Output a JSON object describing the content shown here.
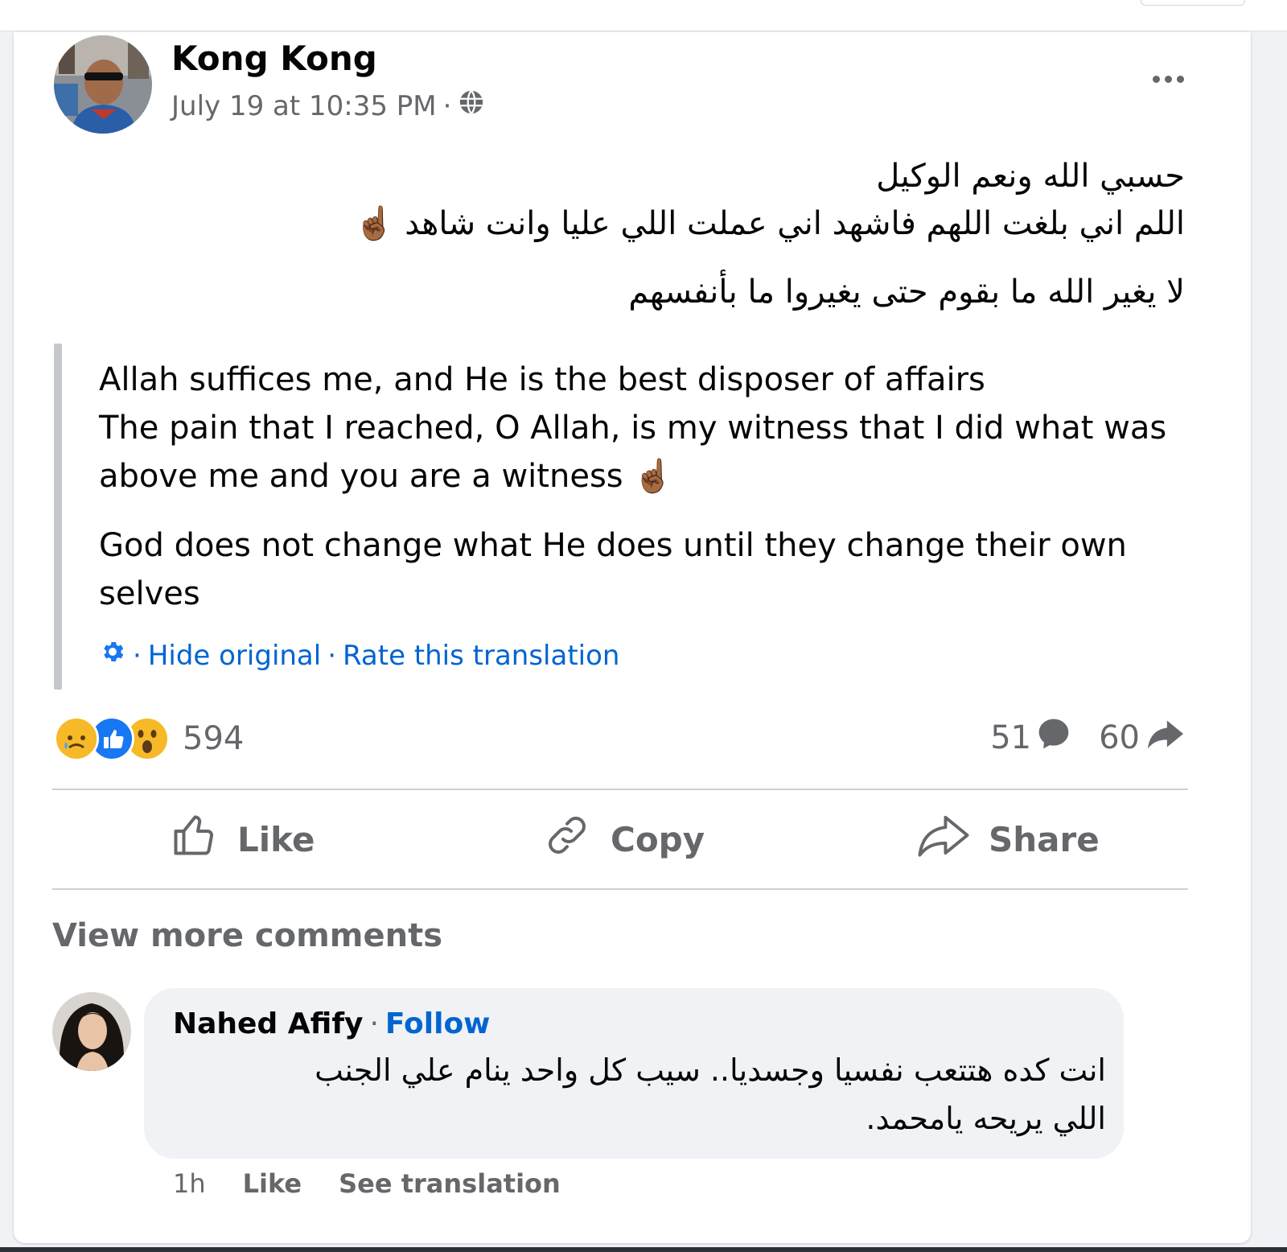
{
  "post": {
    "author": "Kong Kong",
    "timestamp": "July 19 at 10:35 PM",
    "separator": "·",
    "privacy_icon": "globe-icon",
    "more_icon": "more-options-icon",
    "original_lines": [
      "حسبي الله ونعم الوكيل",
      "اللم اني بلغت اللهم فاشهد اني عملت اللي عليا وانت شاهد ☝🏾",
      "لا يغير الله ما بقوم حتى يغيروا ما بأنفسهم"
    ],
    "translation": {
      "para1_line1": "Allah suffices me, and He is the best disposer of affairs",
      "para1_line2": "The pain that I reached, O Allah, is my witness that I did what was",
      "para1_line3": "above me and you are a witness ☝🏾",
      "para2_line1": "God does not change what He does until they change their own",
      "para2_line2": "selves",
      "settings_icon": "gear-icon",
      "hide_original": "Hide original",
      "rate_translation": "Rate this translation"
    },
    "reactions": {
      "types": [
        "sad",
        "like",
        "wow"
      ],
      "count": "594"
    },
    "comments_count": "51",
    "shares_count": "60",
    "actions": {
      "like": "Like",
      "copy": "Copy",
      "share": "Share"
    }
  },
  "comments": {
    "view_more": "View more comments",
    "items": [
      {
        "author": "Nahed Afify",
        "follow": "Follow",
        "line1": "انت كده هتتعب نفسيا وجسديا.. سيب كل واحد ينام علي الجنب",
        "line2": "اللي يريحه يامحمد.",
        "time": "1h",
        "like": "Like",
        "see_translation": "See translation"
      }
    ]
  },
  "colors": {
    "link": "#0064d1",
    "secondary_text": "#65676b",
    "divider": "#ced0d4",
    "bubble": "#f0f2f5",
    "like_blue": "#1877f2",
    "reaction_yellow": "#f7b928"
  }
}
